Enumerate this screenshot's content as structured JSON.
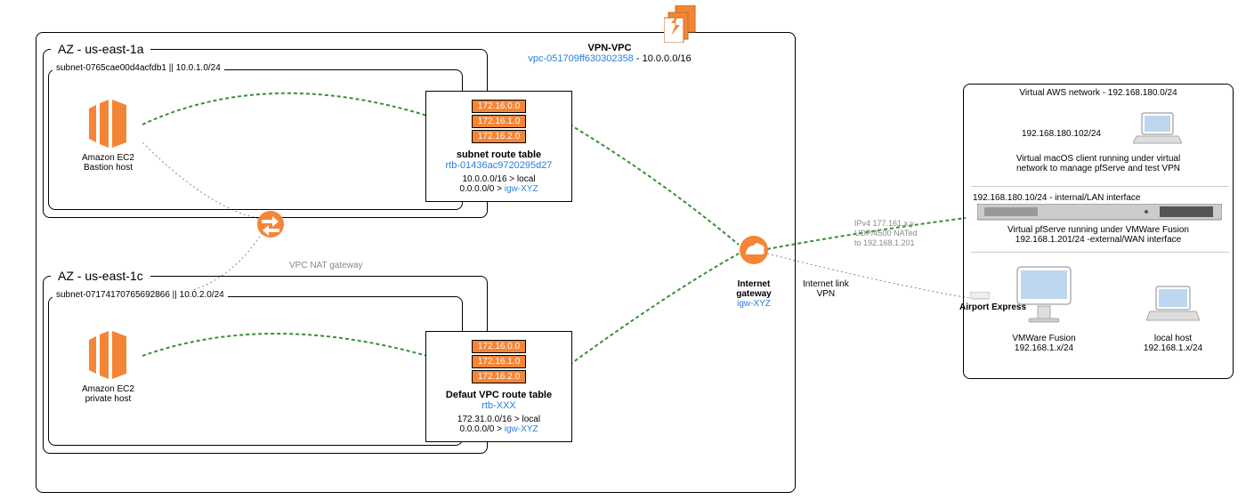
{
  "vpc": {
    "title": "VPN-VPC",
    "vpc_id": "vpc-051709ff630302358",
    "cidr": " - 10.0.0.0/16"
  },
  "az1": {
    "title": "AZ - us-east-1a",
    "subnet_label": "subnet-0765cae00d4acfdb1 || 10.0.1.0/24",
    "ec2_title": "Amazon EC2",
    "ec2_sub": "Bastion host"
  },
  "az2": {
    "title": "AZ - us-east-1c",
    "subnet_label": "subnet-07174170765692866 || 10.0.2.0/24",
    "ec2_title": "Amazon EC2",
    "ec2_sub": "private host"
  },
  "rt1": {
    "cidrs": [
      "172.16.0.0",
      "172.16.1.0",
      "172.16.2.0"
    ],
    "title": "subnet route table",
    "rtb_id": "rtb-01436ac9720295d27",
    "route_local": "10.0.0.0/16 > local",
    "route_def_prefix": "0.0.0.0/0 > ",
    "route_def_link": "igw-XYZ"
  },
  "rt2": {
    "cidrs": [
      "172.16.0.0",
      "172.16.1.0",
      "172.16.2.0"
    ],
    "title": "Defaut VPC route table",
    "rtb_id": "rtb-XXX",
    "route_local": "172.31.0.0/16 > local",
    "route_def_prefix": "0.0.0.0/0 > ",
    "route_def_link": "igw-XYZ"
  },
  "nat": {
    "label": "VPC NAT gateway"
  },
  "igw": {
    "title": "Internet gateway",
    "id": "igw-XYZ"
  },
  "inet": {
    "line1": "Internet link",
    "line2": "VPN"
  },
  "tunnel": {
    "line1": "IPv4 177.161.x.y",
    "line2": "UDP/4500 NATed",
    "line3": "to 192.168.1.201"
  },
  "airport": {
    "label": "Airport Express"
  },
  "remote": {
    "header": "Virtual AWS network - 192.168.180.0/24",
    "macos_ip": "192.168.180.102/24",
    "macos_desc1": "Virtual macOS client running under virtual",
    "macos_desc2": "network to manage pfServe and test VPN",
    "pfserve_ip": "192.168.180.10/24 - internal/LAN interface",
    "pfserve_desc1": "Virtual pfServe running under VMWare Fusion",
    "pfserve_desc2": "192.168.1.201/24 -external/WAN interface",
    "imac_title": "VMWare Fusion",
    "imac_ip": "192.168.1.x/24",
    "mbp_title": "local host",
    "mbp_ip": "192.168.1.x/24"
  }
}
